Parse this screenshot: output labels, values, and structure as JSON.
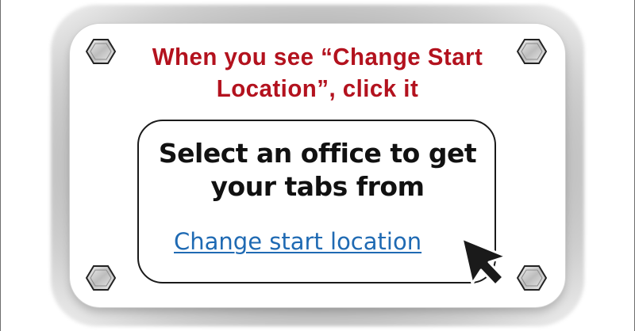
{
  "sign": {
    "instruction": "When you see “Change Start Location”, click it"
  },
  "dialog": {
    "message": "Select an office to get your tabs from",
    "link_label": "Change start location"
  },
  "icons": {
    "screws": [
      "hex-screw-icon",
      "hex-screw-icon",
      "hex-screw-icon",
      "hex-screw-icon"
    ],
    "pointer": "mouse-pointer-icon"
  },
  "colors": {
    "instruction_text": "#b3121e",
    "link": "#1f6ab3",
    "message_text": "#111111"
  }
}
